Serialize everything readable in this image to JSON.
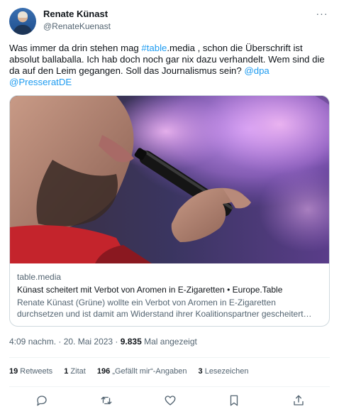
{
  "author": {
    "display_name": "Renate Künast",
    "handle": "@RenateKuenast",
    "more_label": "···"
  },
  "tweet": {
    "text_1": "Was immer da drin stehen mag ",
    "hashtag": "#table",
    "text_2": ".media , schon die Überschrift ist absolut ballaballa. Ich hab doch noch gar nix dazu verhandelt. Wem sind die da auf den Leim gegangen. Soll das Journalismus sein? ",
    "mention_1": "@dpa",
    "mention_2": "@PresseratDE"
  },
  "card": {
    "domain": "table.media",
    "title": "Künast scheitert mit Verbot von Aromen in E-Zigaretten • Europe.Table",
    "description_line1": "Renate Künast (Grüne) wollte ein Verbot von Aromen in E-Zigaretten",
    "description_line2": "durchsetzen und ist damit am Widerstand ihrer Koalitionspartner gescheitert…"
  },
  "meta": {
    "time_date": "4:09 nachm. · 20. Mai 2023 · ",
    "views_count": "9.835",
    "views_label": " Mal angezeigt"
  },
  "stats": {
    "retweets_count": "19",
    "retweets_label": " Retweets",
    "quotes_count": "1",
    "quotes_label": " Zitat",
    "likes_count": "196",
    "likes_label": " „Gefällt mir“-Angaben",
    "bookmarks_count": "3",
    "bookmarks_label": " Lesezeichen"
  },
  "colors": {
    "link": "#1d9bf0",
    "text_primary": "#0f1419",
    "text_secondary": "#536471",
    "border": "#cfd9de"
  },
  "icons": [
    "reply-icon",
    "retweet-icon",
    "like-icon",
    "bookmark-icon",
    "share-icon"
  ]
}
